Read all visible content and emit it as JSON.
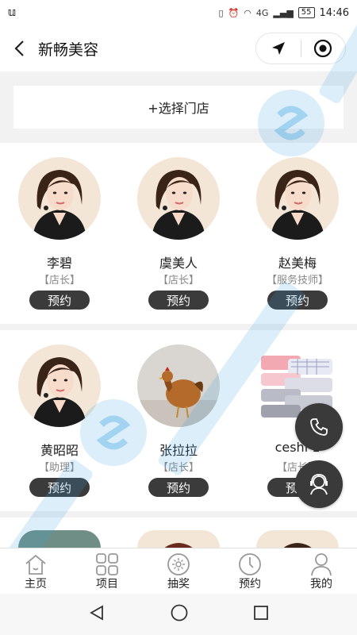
{
  "status_bar": {
    "time": "14:46",
    "network": "4G",
    "battery": "55"
  },
  "header": {
    "title": "新畅美容"
  },
  "store": {
    "select_label": "+选择门店"
  },
  "staff": [
    {
      "name": "李碧",
      "role": "【店长】",
      "book_label": "预约",
      "avatar": "woman-portrait"
    },
    {
      "name": "虞美人",
      "role": "【店长】",
      "book_label": "预约",
      "avatar": "woman-portrait"
    },
    {
      "name": "赵美梅",
      "role": "【服务技师】",
      "book_label": "预约",
      "avatar": "woman-portrait"
    },
    {
      "name": "黄昭昭",
      "role": "【助理】",
      "book_label": "预约",
      "avatar": "woman-portrait"
    },
    {
      "name": "张拉拉",
      "role": "【店长】",
      "book_label": "预约",
      "avatar": "chicken-photo"
    },
    {
      "name": "ceshi 1",
      "role": "【店长】",
      "book_label": "预约",
      "avatar": "towels-photo"
    }
  ],
  "tabbar": {
    "items": [
      {
        "label": "主页",
        "icon": "home-icon"
      },
      {
        "label": "项目",
        "icon": "grid-icon"
      },
      {
        "label": "抽奖",
        "icon": "lottery-icon"
      },
      {
        "label": "预约",
        "icon": "clock-icon"
      },
      {
        "label": "我的",
        "icon": "user-icon"
      }
    ]
  },
  "colors": {
    "button_dark": "#3b3b3b",
    "background": "#f2f2f2",
    "watermark": "#3aa0e0"
  }
}
